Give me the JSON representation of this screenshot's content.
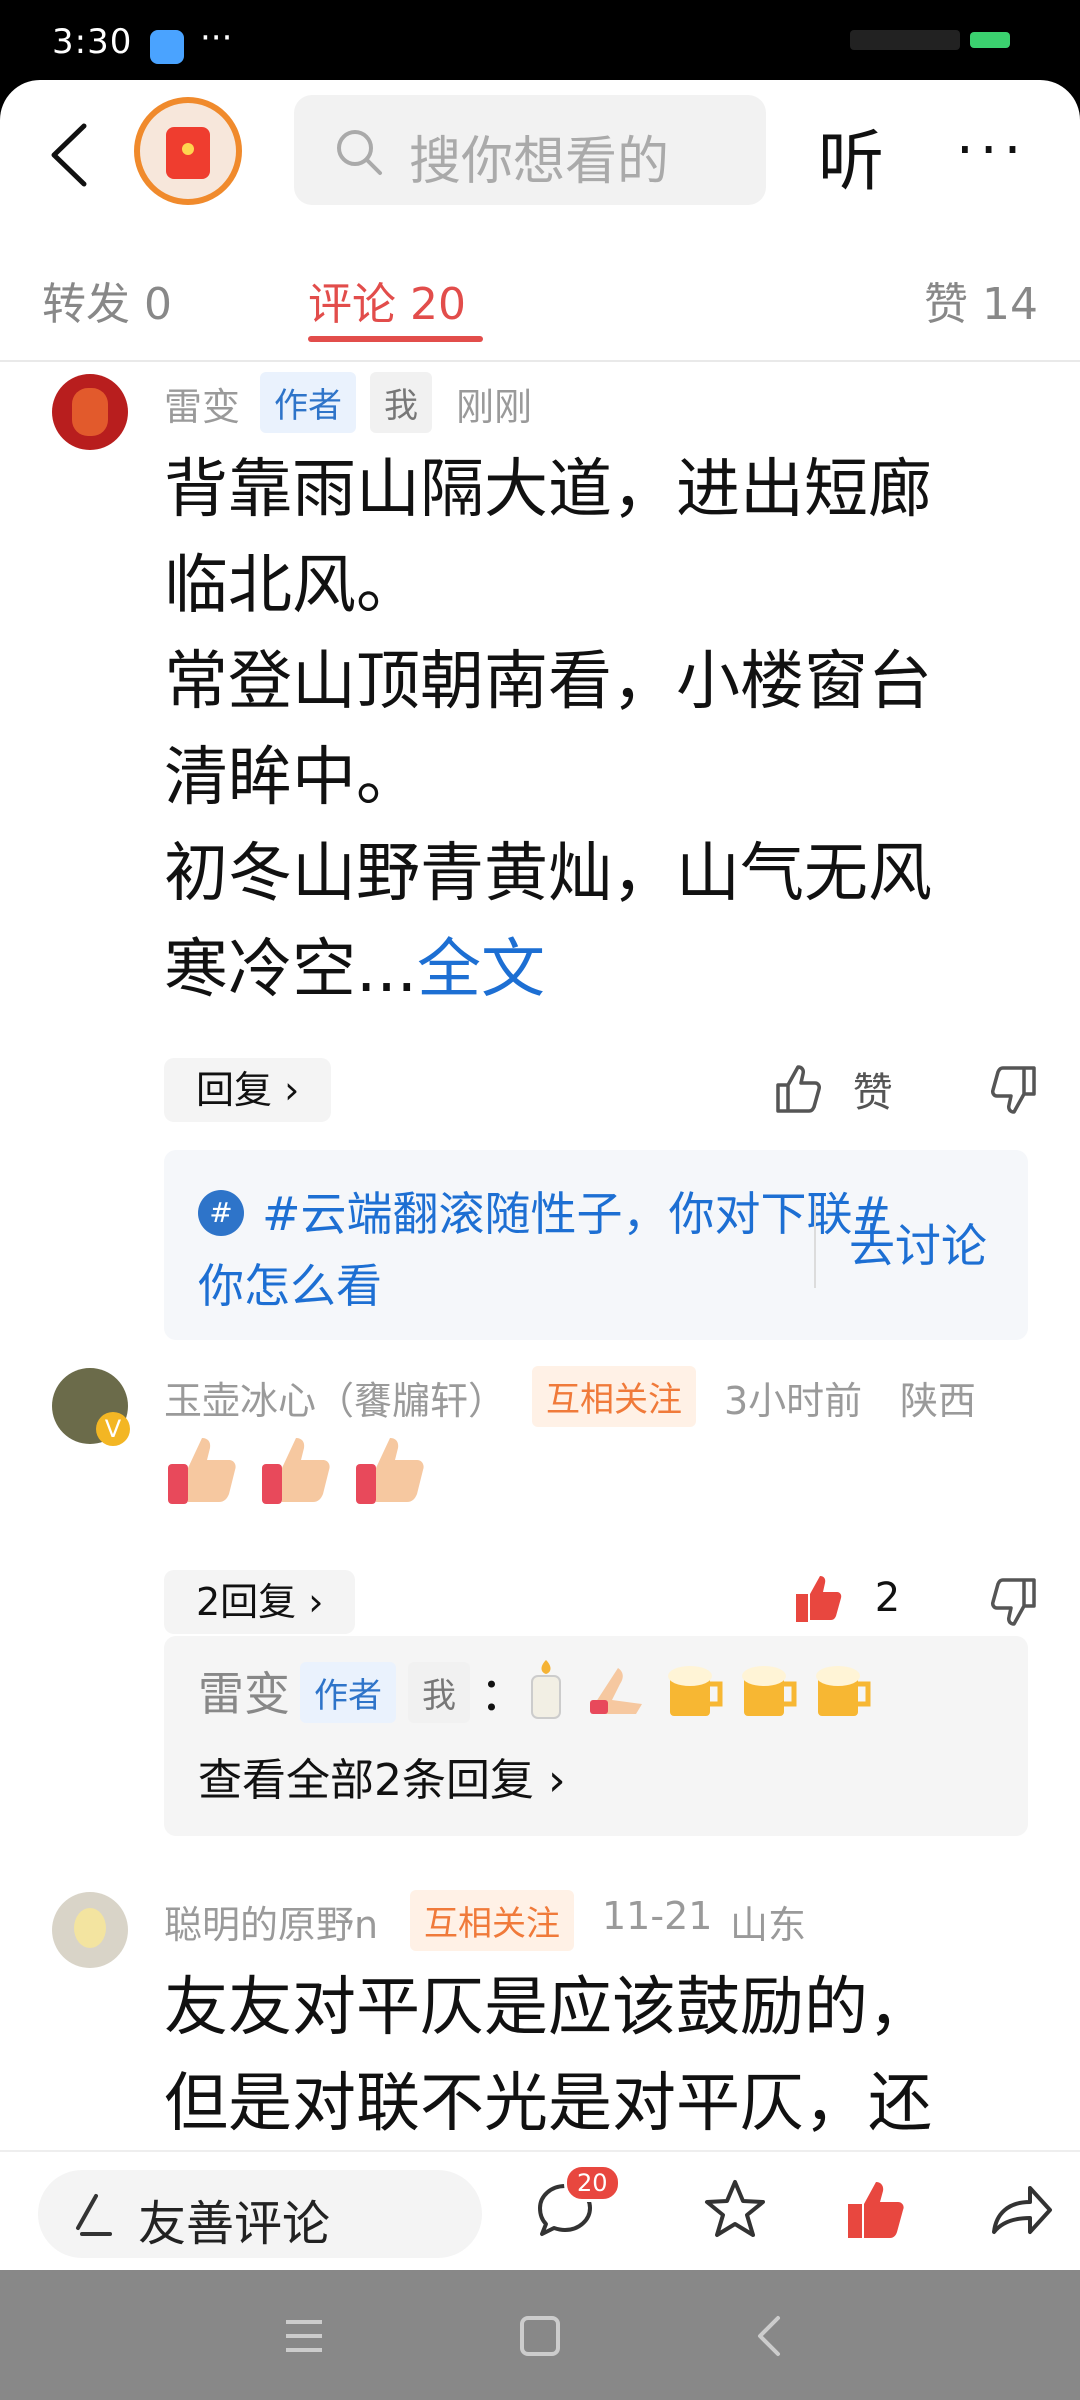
{
  "status": {
    "time": "3:30",
    "dots": "···"
  },
  "nav": {
    "search_placeholder": "搜你想看的",
    "listen_label": "听",
    "more_label": "···"
  },
  "tabs": {
    "forward": "转发 0",
    "comments": "评论 20",
    "likes": "赞 14"
  },
  "comments": [
    {
      "name": "雷变",
      "tags": [
        "作者",
        "我"
      ],
      "time": "刚刚",
      "lines": [
        "背靠雨山隔大道，进出短廊",
        "临北风。",
        "常登山顶朝南看，小楼窗台",
        "清眸中。",
        "初冬山野青黄灿，山气无风",
        "寒冷空..."
      ],
      "readmore": "全文",
      "reply_label": "回复 ›",
      "like_label": "赞",
      "topic": {
        "text": "#云端翻滚随性子，你对下联# 你怎么看",
        "action": "去讨论"
      }
    },
    {
      "name": "玉壶冰心（饔牖轩）",
      "tag": "互相关注",
      "time": "3小时前",
      "location": "陕西",
      "reply_label": "2回复 ›",
      "like_count": "2",
      "sub_reply": {
        "name": "雷变",
        "tags": [
          "作者",
          "我"
        ],
        "sep": "：",
        "view_all": "查看全部2条回复 ›"
      }
    },
    {
      "name": "聪明的原野n",
      "tag": "互相关注",
      "time": "11-21",
      "location": "山东",
      "lines": [
        "友友对平仄是应该鼓励的，",
        "但是对联不光是对平仄，还"
      ]
    }
  ],
  "bottom": {
    "comment_placeholder": "友善评论",
    "comment_badge": "20"
  },
  "colors": {
    "accent_red": "#e24d4b",
    "link_blue": "#1d6fd3",
    "tag_orange": "#f07a3a"
  }
}
